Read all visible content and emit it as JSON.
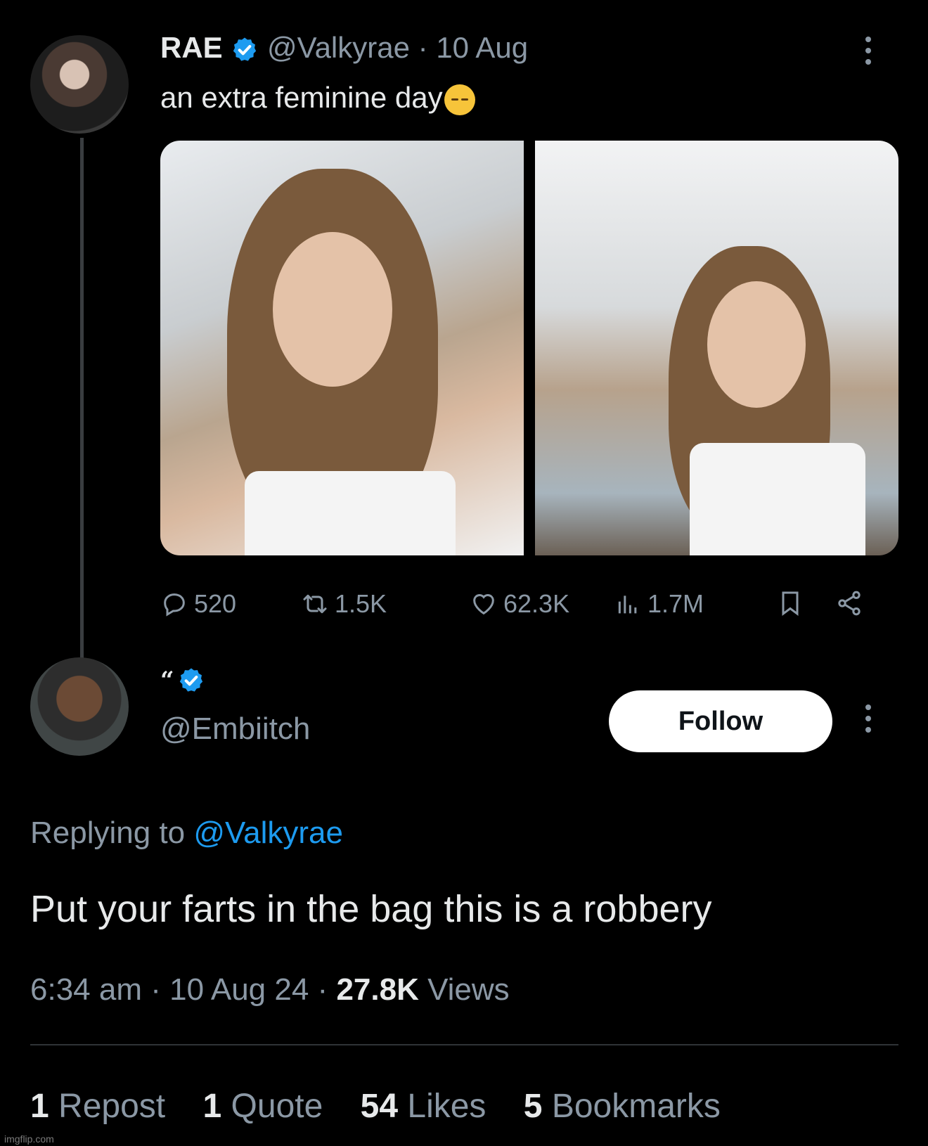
{
  "original_tweet": {
    "display_name": "RAE",
    "handle": "@Valkyrae",
    "separator": "·",
    "date": "10 Aug",
    "text": "an extra feminine day",
    "emoji": "relieved-face-emoji",
    "actions": {
      "replies": "520",
      "reposts": "1.5K",
      "likes": "62.3K",
      "views": "1.7M"
    }
  },
  "reply_tweet": {
    "display_name": "“",
    "handle": "@Embiitch",
    "follow_label": "Follow",
    "replying_prefix": "Replying to",
    "replying_to": "@Valkyrae",
    "text": "Put your farts in the bag this is a robbery",
    "time": "6:34 am",
    "date": "10 Aug 24",
    "views_count": "27.8K",
    "views_label": "Views",
    "stats": {
      "reposts_count": "1",
      "reposts_label": "Repost",
      "quotes_count": "1",
      "quotes_label": "Quote",
      "likes_count": "54",
      "likes_label": "Likes",
      "bookmarks_count": "5",
      "bookmarks_label": "Bookmarks"
    }
  },
  "watermark": "imgflip.com",
  "colors": {
    "background": "#000000",
    "text": "#e7e9ea",
    "muted": "#8b98a5",
    "link": "#1d9bf0",
    "verified": "#1d9bf0",
    "follow_bg": "#ffffff"
  }
}
